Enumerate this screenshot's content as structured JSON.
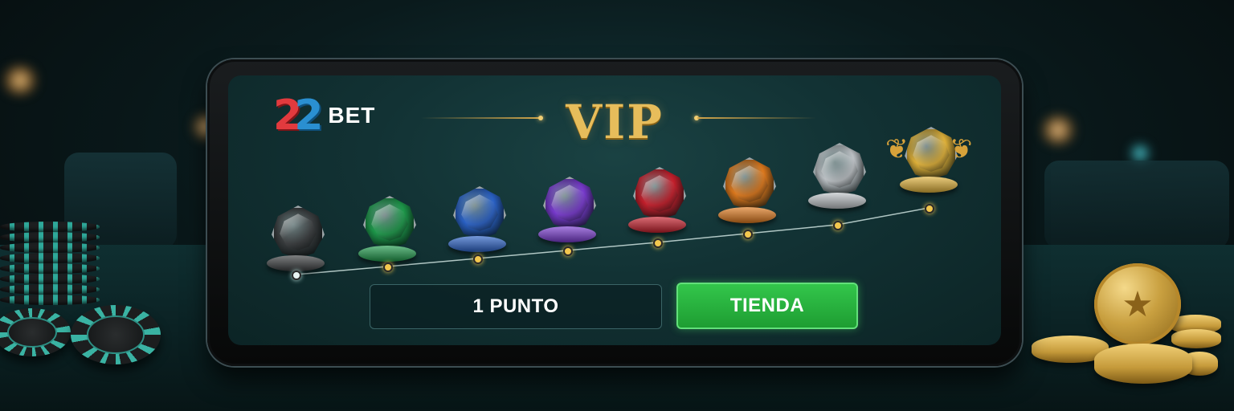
{
  "brand": {
    "logo_digits": "22",
    "logo_word": "BET"
  },
  "header": {
    "title": "VIP"
  },
  "colors": {
    "title_gold": "#e7bd5b",
    "button_green": "#2bb443",
    "screen_bg": "#123234",
    "progress_node": "#f3c74e"
  },
  "levels": [
    {
      "gem": "black-gem-icon",
      "color": "#3a3d3f"
    },
    {
      "gem": "green-gem-icon",
      "color": "#1e9a4b"
    },
    {
      "gem": "blue-gem-icon",
      "color": "#2b63c9"
    },
    {
      "gem": "purple-gem-icon",
      "color": "#7a3bd1"
    },
    {
      "gem": "red-gem-icon",
      "color": "#c81f2c"
    },
    {
      "gem": "orange-gem-icon",
      "color": "#e07a1d"
    },
    {
      "gem": "silver-gem-icon",
      "color": "#bfc4c8"
    },
    {
      "gem": "gold-gem-icon",
      "color": "#e2b33a"
    }
  ],
  "points": {
    "label": "1 PUNTO"
  },
  "shop": {
    "label": "TIENDA"
  }
}
